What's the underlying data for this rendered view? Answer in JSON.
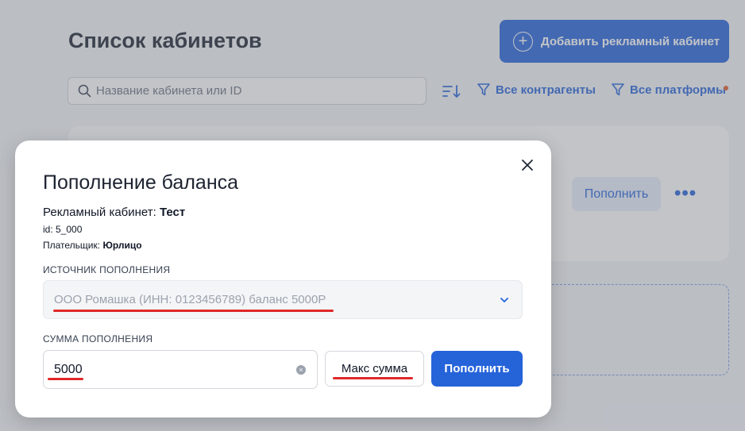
{
  "page": {
    "title": "Список кабинетов",
    "add_button": "Добавить рекламный кабинет",
    "search_placeholder": "Название кабинета или ID",
    "filter_contractors": "Все контрагенты",
    "filter_platforms": "Все платформы",
    "card_button": "Пополнить",
    "more_glyph": "•••"
  },
  "modal": {
    "title": "Пополнение баланса",
    "cabinet_label": "Рекламный кабинет:",
    "cabinet_name": "Тест",
    "id_line": "id: 5_000",
    "payer_label": "Плательщик:",
    "payer_value": "Юрлицо",
    "source_label": "ИСТОЧНИК ПОПОЛНЕНИЯ",
    "source_value": "ООО Ромашка (ИНН: 0123456789) баланс 5000Р",
    "amount_label": "СУММА ПОПОЛНЕНИЯ",
    "amount_value": "5000",
    "max_button": "Макс сумма",
    "submit_button": "Пополнить"
  },
  "colors": {
    "accent": "#2563d9",
    "highlight_underline": "#e0282a",
    "notification_dot": "#e65a2a"
  },
  "icons": [
    "plus-circle-icon",
    "search-icon",
    "sort-icon",
    "filter-icon",
    "close-icon",
    "chevron-down-icon",
    "clear-icon",
    "more-icon"
  ]
}
